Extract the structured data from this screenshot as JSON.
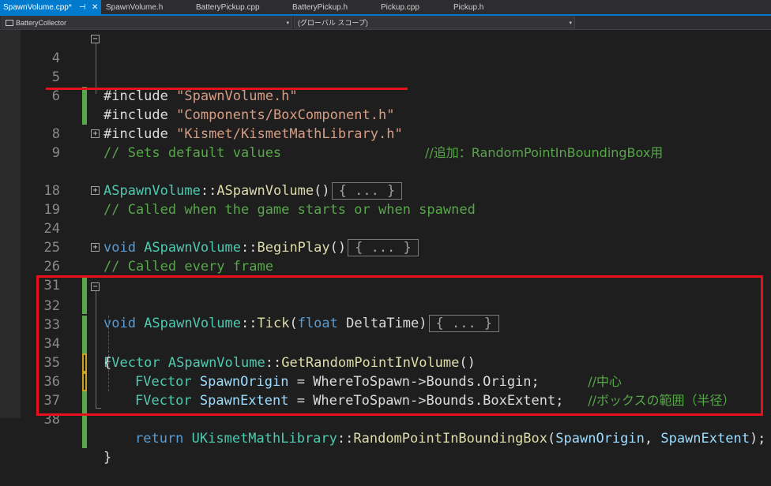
{
  "tabs": [
    {
      "label": "SpawnVolume.cpp*",
      "active": true
    },
    {
      "label": "SpawnVolume.h",
      "active": false
    },
    {
      "label": "BatteryPickup.cpp",
      "active": false
    },
    {
      "label": "BatteryPickup.h",
      "active": false
    },
    {
      "label": "Pickup.cpp",
      "active": false
    },
    {
      "label": "Pickup.h",
      "active": false
    }
  ],
  "tab_icons": {
    "pin": "pin-icon",
    "close": "close-icon"
  },
  "tab_glyphs": {
    "pin": "⊣",
    "close": "✕"
  },
  "nav": {
    "project": "BatteryCollector",
    "scope": "(グローバル スコープ)",
    "arrow": "▾"
  },
  "fold_glyphs": {
    "minus": "−",
    "plus": "+"
  },
  "lines": {
    "l4": {
      "num": "4",
      "kw": "#include ",
      "str": "\"SpawnVolume.h\""
    },
    "l5": {
      "num": "5",
      "kw": "#include ",
      "str": "\"Components/BoxComponent.h\""
    },
    "l6": {
      "num": "6",
      "kw": "#include ",
      "str": "\"Kismet/KismetMathLibrary.h\"",
      "comment": "//追加：RandomPointInBoundingBox用"
    },
    "l8": {
      "num": "8",
      "comment": "// Sets default values"
    },
    "l9": {
      "num": "9",
      "cls": "ASpawnVolume",
      "sep": "::",
      "fn": "ASpawnVolume",
      "paren": "()",
      "collapsed": "{ ... }"
    },
    "l18": {
      "num": "18",
      "comment": "// Called when the game starts or when spawned"
    },
    "l19": {
      "num": "19",
      "kw": "void ",
      "cls": "ASpawnVolume",
      "sep": "::",
      "fn": "BeginPlay",
      "paren": "()",
      "collapsed": "{ ... }"
    },
    "l24": {
      "num": "24"
    },
    "l25": {
      "num": "25",
      "comment": "// Called every frame"
    },
    "l26": {
      "num": "26",
      "kw": "void ",
      "cls": "ASpawnVolume",
      "sep": "::",
      "fn": "Tick",
      "open": "(",
      "ptype": "float",
      "pname": " DeltaTime",
      "close": ")",
      "collapsed": "{ ... }"
    },
    "l31": {
      "num": "31"
    },
    "l32": {
      "num": "32",
      "type": "FVector ",
      "cls": "ASpawnVolume",
      "sep": "::",
      "fn": "GetRandomPointInVolume",
      "paren": "()"
    },
    "l33": {
      "num": "33",
      "brace": "{"
    },
    "l34": {
      "num": "34",
      "type": "FVector ",
      "var": "SpawnOrigin",
      "rest": " = WhereToSpawn->Bounds.Origin;",
      "pad": "      ",
      "comment": "//中心"
    },
    "l35": {
      "num": "35",
      "type": "FVector ",
      "var": "SpawnExtent",
      "rest": " = WhereToSpawn->Bounds.BoxExtent;",
      "pad": "   ",
      "comment": "//ボックスの範囲（半径）"
    },
    "l36": {
      "num": "36"
    },
    "l37": {
      "num": "37",
      "kw": "return ",
      "cls": "UKismetMathLibrary",
      "sep": "::",
      "fn": "RandomPointInBoundingBox",
      "open": "(",
      "a1": "SpawnOrigin",
      "comma": ", ",
      "a2": "SpawnExtent",
      "end": ");"
    },
    "l38": {
      "num": "38",
      "brace": "}"
    }
  },
  "colors": {
    "keyword": "#569cd6",
    "string": "#d69d85",
    "comment": "#57a64a",
    "type": "#4ec9b0",
    "function": "#dcdcaa",
    "variable": "#9cdcfe",
    "highlight": "#e8101a",
    "accent": "#007acc"
  }
}
